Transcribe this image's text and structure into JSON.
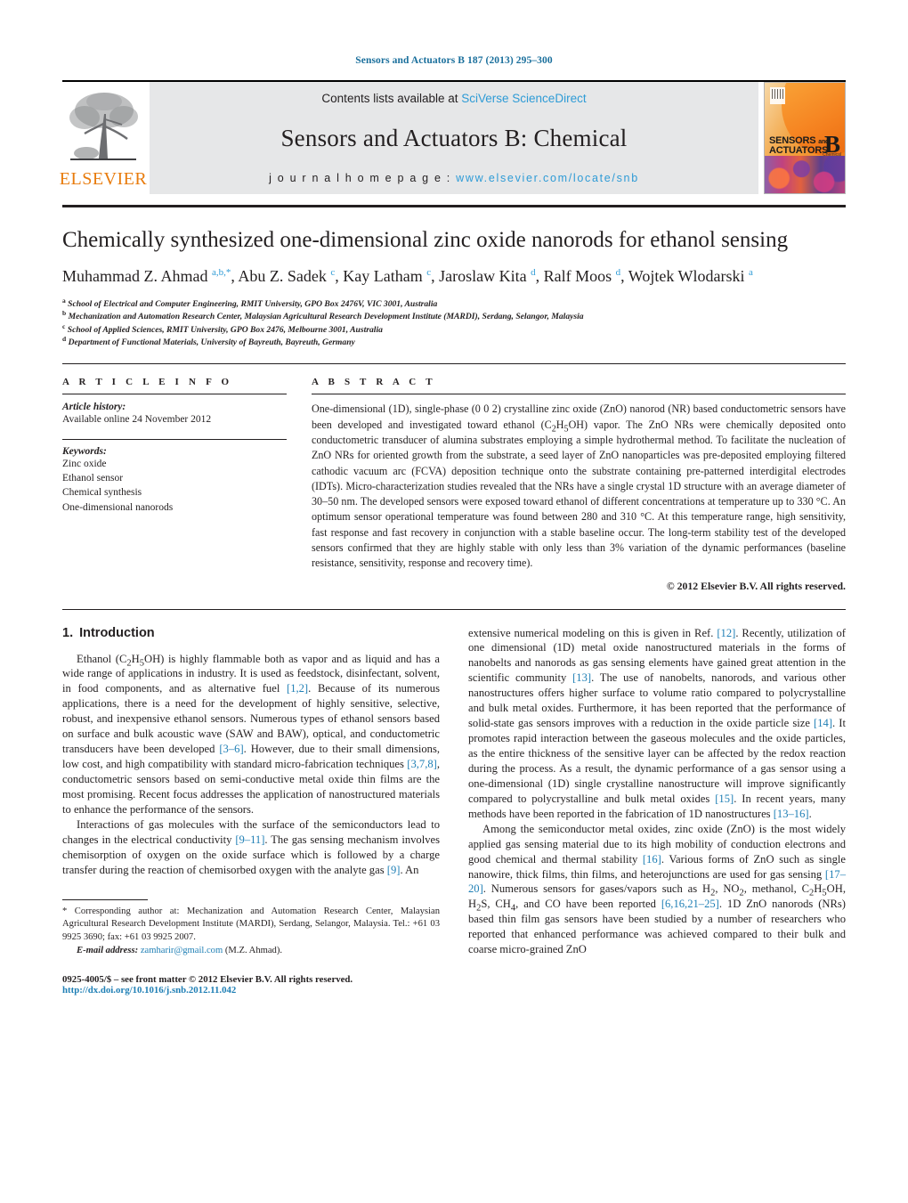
{
  "running_head": "Sensors and Actuators B 187 (2013) 295–300",
  "masthead": {
    "publisher_wordmark": "ELSEVIER",
    "contents_prefix": "Contents lists available at ",
    "contents_link": "SciVerse ScienceDirect",
    "journal_title": "Sensors and Actuators B: Chemical",
    "homepage_prefix": "j o u r n a l   h o m e p a g e :",
    "homepage_url": "www.elsevier.com/locate/snb",
    "cover": {
      "line1": "SENSORS",
      "line1_and": "and",
      "line2": "ACTUATORS",
      "letter": "B",
      "sub": "Chemical"
    }
  },
  "article": {
    "title": "Chemically synthesized one-dimensional zinc oxide nanorods for ethanol sensing",
    "authors_html": "Muhammad Z. Ahmad <sup>a,b,</sup><sup>*</sup>, Abu Z. Sadek <sup>c</sup>, Kay Latham <sup>c</sup>, Jaroslaw Kita <sup>d</sup>, Ralf Moos <sup>d</sup>, Wojtek Wlodarski <sup>a</sup>",
    "affiliations": [
      {
        "marker": "a",
        "text": "School of Electrical and Computer Engineering, RMIT University, GPO Box 2476V, VIC 3001, Australia"
      },
      {
        "marker": "b",
        "text": "Mechanization and Automation Research Center, Malaysian Agricultural Research Development Institute (MARDI), Serdang, Selangor, Malaysia"
      },
      {
        "marker": "c",
        "text": "School of Applied Sciences, RMIT University, GPO Box 2476, Melbourne 3001, Australia"
      },
      {
        "marker": "d",
        "text": "Department of Functional Materials, University of Bayreuth, Bayreuth, Germany"
      }
    ]
  },
  "article_info": {
    "heading": "A R T I C L E   I N F O",
    "history_label": "Article history:",
    "history_value": "Available online 24 November 2012",
    "keywords_label": "Keywords:",
    "keywords": [
      "Zinc oxide",
      "Ethanol sensor",
      "Chemical synthesis",
      "One-dimensional nanorods"
    ]
  },
  "abstract": {
    "heading": "A B S T R A C T",
    "text_html": "One-dimensional (1D), single-phase (0 0 2) crystalline zinc oxide (ZnO) nanorod (NR) based conductometric sensors have been developed and investigated toward ethanol (C<sub>2</sub>H<sub>5</sub>OH) vapor. The ZnO NRs were chemically deposited onto conductometric transducer of alumina substrates employing a simple hydrothermal method. To facilitate the nucleation of ZnO NRs for oriented growth from the substrate, a seed layer of ZnO nanoparticles was pre-deposited employing filtered cathodic vacuum arc (FCVA) deposition technique onto the substrate containing pre-patterned interdigital electrodes (IDTs). Micro-characterization studies revealed that the NRs have a single crystal 1D structure with an average diameter of 30–50 nm. The developed sensors were exposed toward ethanol of different concentrations at temperature up to 330 &#176;C. An optimum sensor operational temperature was found between 280 and 310 &#176;C. At this temperature range, high sensitivity, fast response and fast recovery in conjunction with a stable baseline occur. The long-term stability test of the developed sensors confirmed that they are highly stable with only less than 3% variation of the dynamic performances (baseline resistance, sensitivity, response and recovery time).",
    "copyright": "© 2012 Elsevier B.V. All rights reserved."
  },
  "body": {
    "section_number": "1.",
    "section_title": "Introduction",
    "left_paragraphs_html": [
      "Ethanol (C<sub>2</sub>H<sub>5</sub>OH) is highly flammable both as vapor and as liquid and has a wide range of applications in industry. It is used as feedstock, disinfectant, solvent, in food components, and as alternative fuel <span class=\"ref\">[1,2]</span>. Because of its numerous applications, there is a need for the development of highly sensitive, selective, robust, and inexpensive ethanol sensors. Numerous types of ethanol sensors based on surface and bulk acoustic wave (SAW and BAW), optical, and conductometric transducers have been developed <span class=\"ref\">[3–6]</span>. However, due to their small dimensions, low cost, and high compatibility with standard micro-fabrication techniques <span class=\"ref\">[3,7,8]</span>, conductometric sensors based on semi-conductive metal oxide thin films are the most promising. Recent focus addresses the application of nanostructured materials to enhance the performance of the sensors.",
      "Interactions of gas molecules with the surface of the semiconductors lead to changes in the electrical conductivity <span class=\"ref\">[9–11]</span>. The gas sensing mechanism involves chemisorption of oxygen on the oxide surface which is followed by a charge transfer during the reaction of chemisorbed oxygen with the analyte gas <span class=\"ref\">[9]</span>. An"
    ],
    "right_paragraphs_html": [
      "extensive numerical modeling on this is given in Ref. <span class=\"ref\">[12]</span>. Recently, utilization of one dimensional (1D) metal oxide nanostructured materials in the forms of nanobelts and nanorods as gas sensing elements have gained great attention in the scientific community <span class=\"ref\">[13]</span>. The use of nanobelts, nanorods, and various other nanostructures offers higher surface to volume ratio compared to polycrystalline and bulk metal oxides. Furthermore, it has been reported that the performance of solid-state gas sensors improves with a reduction in the oxide particle size <span class=\"ref\">[14]</span>. It promotes rapid interaction between the gaseous molecules and the oxide particles, as the entire thickness of the sensitive layer can be affected by the redox reaction during the process. As a result, the dynamic performance of a gas sensor using a one-dimensional (1D) single crystalline nanostructure will improve significantly compared to polycrystalline and bulk metal oxides <span class=\"ref\">[15]</span>. In recent years, many methods have been reported in the fabrication of 1D nanostructures <span class=\"ref\">[13–16]</span>.",
      "Among the semiconductor metal oxides, zinc oxide (ZnO) is the most widely applied gas sensing material due to its high mobility of conduction electrons and good chemical and thermal stability <span class=\"ref\">[16]</span>. Various forms of ZnO such as single nanowire, thick films, thin films, and heterojunctions are used for gas sensing <span class=\"ref\">[17–20]</span>. Numerous sensors for gases/vapors such as H<sub>2</sub>, NO<sub>2</sub>, methanol, C<sub>2</sub>H<sub>5</sub>OH, H<sub>2</sub>S, CH<sub>4</sub>, and CO have been reported <span class=\"ref\">[6,16,21–25]</span>. 1D ZnO nanorods (NRs) based thin film gas sensors have been studied by a number of researchers who reported that enhanced performance was achieved compared to their bulk and coarse micro-grained ZnO"
    ]
  },
  "footnote": {
    "corresponding_html": "<span class=\"star\">*</span> Corresponding author at: Mechanization and Automation Research Center, Malaysian Agricultural Research Development Institute (MARDI), Serdang, Selangor, Malaysia. Tel.: +61 03 9925 3690; fax: +61 03 9925 2007.",
    "email_label": "E-mail address:",
    "email": "zamharir@gmail.com",
    "email_owner": "(M.Z. Ahmad).",
    "issn_line": "0925-4005/$ – see front matter © 2012 Elsevier B.V. All rights reserved.",
    "doi_line": "http://dx.doi.org/10.1016/j.snb.2012.11.042"
  },
  "colors": {
    "link_blue": "#2e9bd6",
    "ref_blue": "#1f7fb5",
    "runhead_blue": "#1a6f9c",
    "elsevier_orange": "#E87B0C",
    "band_gray": "#e6e7e8",
    "ink": "#231f20"
  }
}
